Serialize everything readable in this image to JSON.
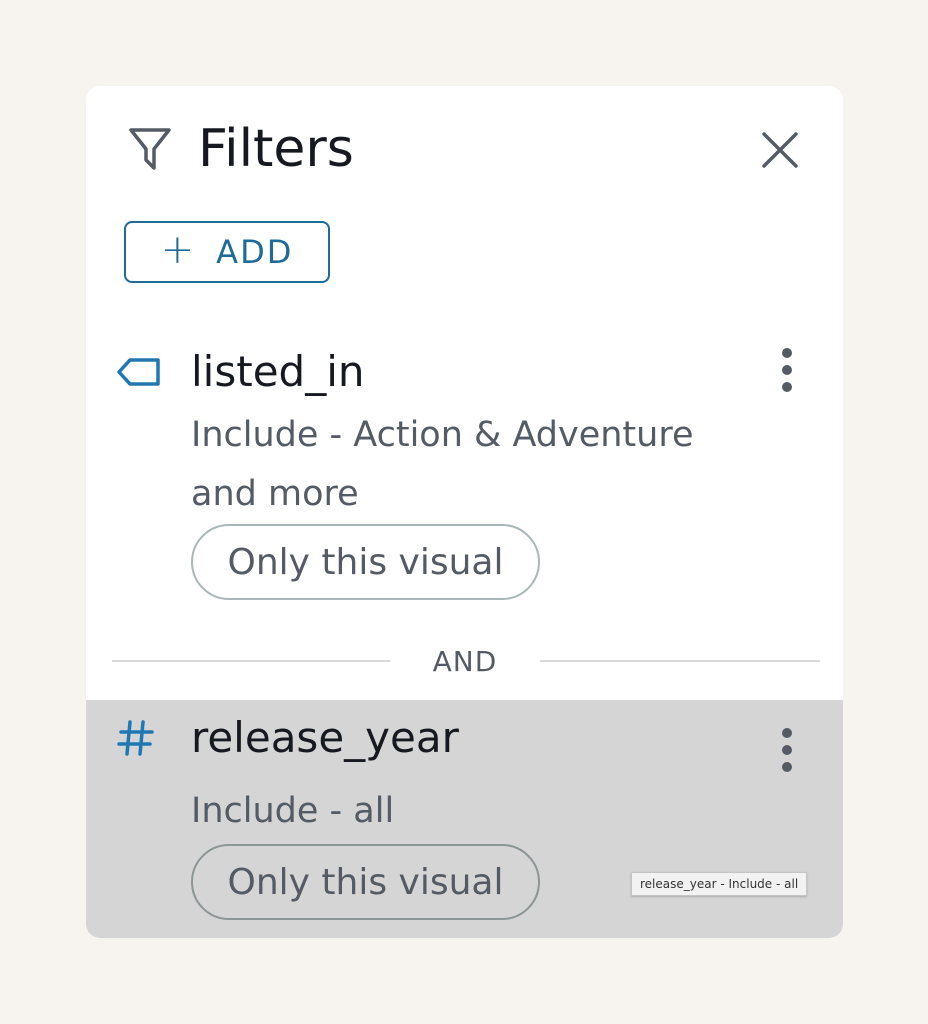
{
  "panel": {
    "title": "Filters",
    "icons": {
      "header": "filter-funnel-icon",
      "close": "close-icon"
    },
    "add_button": {
      "icon": "plus-icon",
      "label": "ADD"
    }
  },
  "filters": [
    {
      "field": "listed_in",
      "type_icon": "dimension-tag-icon",
      "description": "Include - Action & Adventure and more",
      "scope": "Only this visual"
    },
    {
      "field": "release_year",
      "type_icon": "numeric-hash-icon",
      "description": "Include - all",
      "scope": "Only this visual"
    }
  ],
  "connector": "AND",
  "tooltip": "release_year - Include - all",
  "colors": {
    "accent": "#1f6b97",
    "icon_blue": "#1f78b4",
    "text_primary": "#16191f",
    "text_secondary": "#545b64",
    "hover_row": "#d5d5d5",
    "page_bg": "#f7f4ef"
  }
}
